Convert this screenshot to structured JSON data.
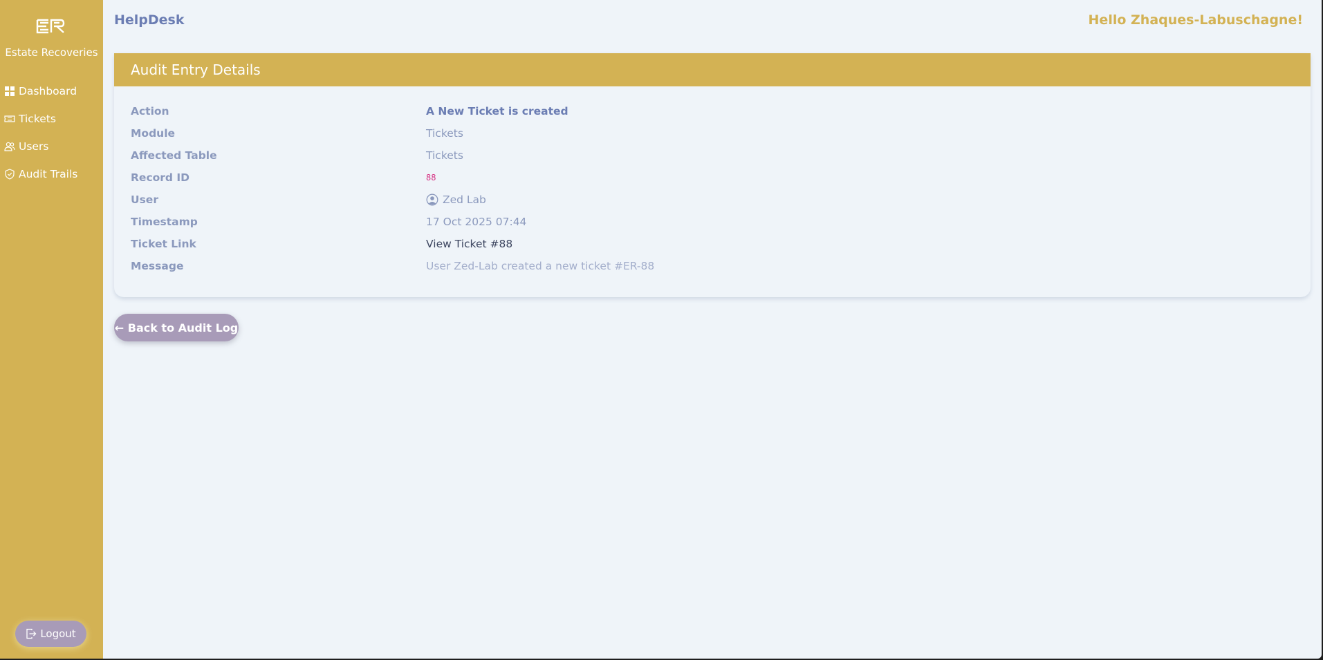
{
  "sidebar": {
    "brand": "Estate Recoveries",
    "items": [
      {
        "label": "Dashboard",
        "icon": "dashboard-icon"
      },
      {
        "label": "Tickets",
        "icon": "ticket-icon"
      },
      {
        "label": "Users",
        "icon": "users-icon"
      },
      {
        "label": "Audit Trails",
        "icon": "shield-icon"
      }
    ],
    "logout_label": "Logout"
  },
  "header": {
    "app_title": "HelpDesk",
    "greeting": "Hello Zhaques-Labuschagne!"
  },
  "card": {
    "title": "Audit Entry Details",
    "rows": [
      {
        "label": "Action",
        "value": "A New Ticket is created"
      },
      {
        "label": "Module",
        "value": "Tickets"
      },
      {
        "label": "Affected Table",
        "value": "Tickets"
      },
      {
        "label": "Record ID",
        "value": "88"
      },
      {
        "label": "User",
        "value": "Zed Lab",
        "icon": "user-circle-icon"
      },
      {
        "label": "Timestamp",
        "value": "17 Oct 2025 07:44"
      },
      {
        "label": "Ticket Link",
        "value": "View Ticket #88"
      },
      {
        "label": "Message",
        "value": "User Zed-Lab created a new ticket #ER-88"
      }
    ]
  },
  "back_button": {
    "label": "← Back to Audit Log"
  },
  "colors": {
    "sidebar": "#d3b254",
    "header_accent": "#d3b254",
    "button": "#a89bb8",
    "title": "#6b7db3",
    "background": "#eff4f9"
  }
}
